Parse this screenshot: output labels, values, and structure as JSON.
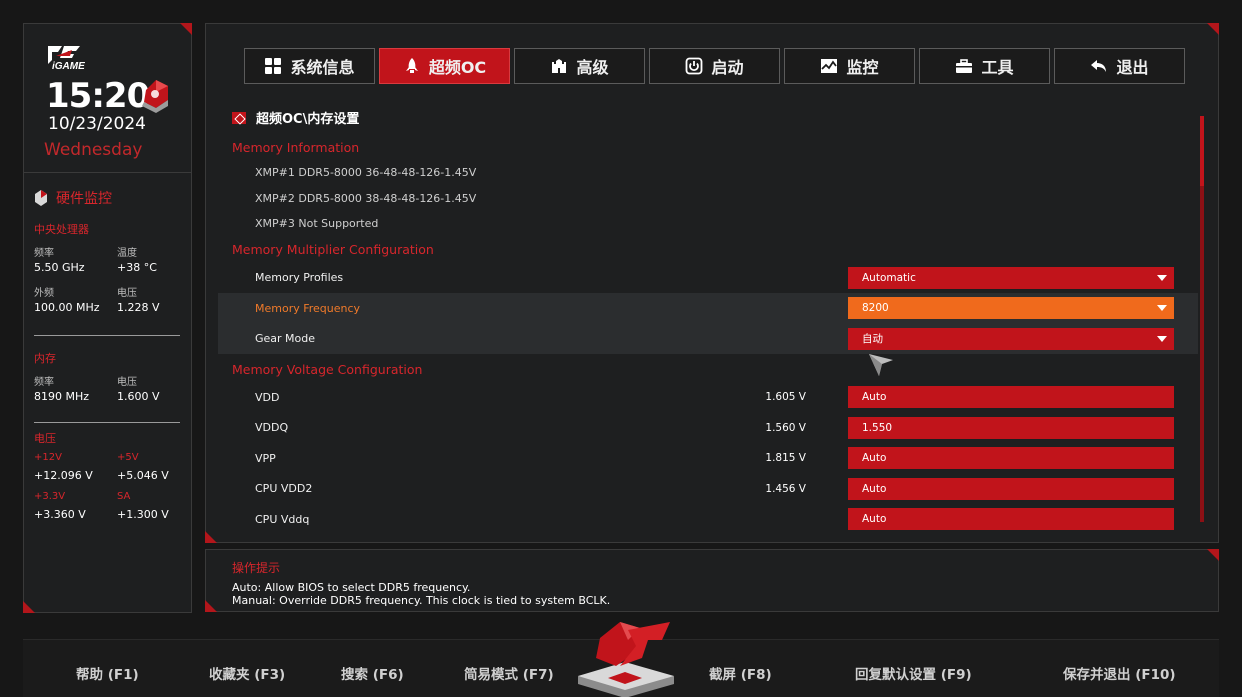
{
  "sidebar": {
    "logo_text": "iGAME",
    "time": "15:20",
    "date": "10/23/2024",
    "weekday": "Wednesday",
    "hw_title": "硬件监控",
    "cpu": {
      "title": "中央处理器",
      "freq_label": "频率",
      "freq_value": "5.50 GHz",
      "temp_label": "温度",
      "temp_value": "+38 °C",
      "bclk_label": "外频",
      "bclk_value": "100.00 MHz",
      "volt_label": "电压",
      "volt_value": "1.228 V"
    },
    "memory": {
      "title": "内存",
      "freq_label": "频率",
      "freq_value": "8190 MHz",
      "volt_label": "电压",
      "volt_value": "1.600 V"
    },
    "voltage": {
      "title": "电压",
      "v12_label": "+12V",
      "v12_value": "+12.096 V",
      "v5_label": "+5V",
      "v5_value": "+5.046 V",
      "v33_label": "+3.3V",
      "v33_value": "+3.360 V",
      "sa_label": "SA",
      "sa_value": "+1.300 V"
    }
  },
  "tabs": [
    {
      "label": "系统信息",
      "icon": "grid-icon"
    },
    {
      "label": "超频OC",
      "icon": "rocket-icon",
      "active": true
    },
    {
      "label": "高级",
      "icon": "castle-icon"
    },
    {
      "label": "启动",
      "icon": "power-icon"
    },
    {
      "label": "监控",
      "icon": "chart-icon"
    },
    {
      "label": "工具",
      "icon": "toolbox-icon"
    },
    {
      "label": "退出",
      "icon": "return-icon"
    }
  ],
  "breadcrumb": "超频OC\\内存设置",
  "sections": {
    "mem_info": "Memory Information",
    "mem_mult": "Memory Multiplier Configuration",
    "mem_volt": "Memory Voltage Configuration"
  },
  "xmp": [
    "XMP#1 DDR5-8000 36-48-48-126-1.45V",
    "XMP#2 DDR5-8000 38-48-48-126-1.45V",
    "XMP#3 Not Supported"
  ],
  "settings": {
    "profiles": {
      "label": "Memory Profiles",
      "value": "Automatic"
    },
    "frequency": {
      "label": "Memory Frequency",
      "value": "8200"
    },
    "gear": {
      "label": "Gear Mode",
      "value": "自动"
    }
  },
  "voltages": [
    {
      "label": "VDD",
      "reading": "1.605 V",
      "value": "Auto"
    },
    {
      "label": "VDDQ",
      "reading": "1.560 V",
      "value": "1.550"
    },
    {
      "label": "VPP",
      "reading": "1.815 V",
      "value": "Auto"
    },
    {
      "label": "CPU VDD2",
      "reading": "1.456 V",
      "value": "Auto"
    },
    {
      "label": "CPU Vddq",
      "reading": "",
      "value": "Auto"
    }
  ],
  "hint": {
    "title": "操作提示",
    "line1": "Auto: Allow BIOS to select DDR5 frequency.",
    "line2": "Manual: Override DDR5 frequency. This clock is tied to system BCLK."
  },
  "footer": {
    "help": "帮助 (F1)",
    "favorites": "收藏夹 (F3)",
    "search": "搜索 (F6)",
    "easy": "简易模式 (F7)",
    "screenshot": "截屏 (F8)",
    "defaults": "回复默认设置 (F9)",
    "save_exit": "保存并退出 (F10)"
  },
  "colors": {
    "accent": "#c1141b",
    "highlight": "#f06a1c",
    "section": "#d7262c"
  }
}
